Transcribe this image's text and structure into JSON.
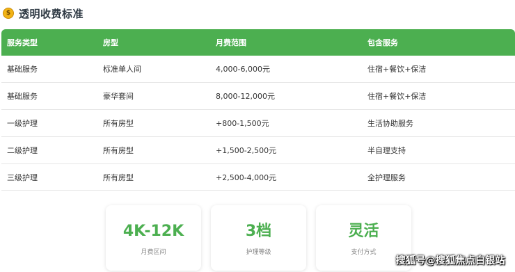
{
  "section": {
    "icon": "money-bag-icon",
    "icon_glyph": "$",
    "title": "透明收费标准"
  },
  "table": {
    "headers": [
      "服务类型",
      "房型",
      "月费范围",
      "包含服务"
    ],
    "rows": [
      [
        "基础服务",
        "标准单人间",
        "4,000-6,000元",
        "住宿+餐饮+保洁"
      ],
      [
        "基础服务",
        "豪华套间",
        "8,000-12,000元",
        "住宿+餐饮+保洁"
      ],
      [
        "一级护理",
        "所有房型",
        "+800-1,500元",
        "生活协助服务"
      ],
      [
        "二级护理",
        "所有房型",
        "+1,500-2,500元",
        "半自理支持"
      ],
      [
        "三级护理",
        "所有房型",
        "+2,500-4,000元",
        "全护理服务"
      ]
    ]
  },
  "cards": [
    {
      "value": "4K-12K",
      "label": "月费区间"
    },
    {
      "value": "3档",
      "label": "护理等级"
    },
    {
      "value": "灵活",
      "label": "支付方式"
    }
  ],
  "watermark": "搜狐号@搜狐焦点白银站",
  "colors": {
    "accent": "#4caf50",
    "header_text": "#ffffff",
    "title": "#2f3a44"
  }
}
